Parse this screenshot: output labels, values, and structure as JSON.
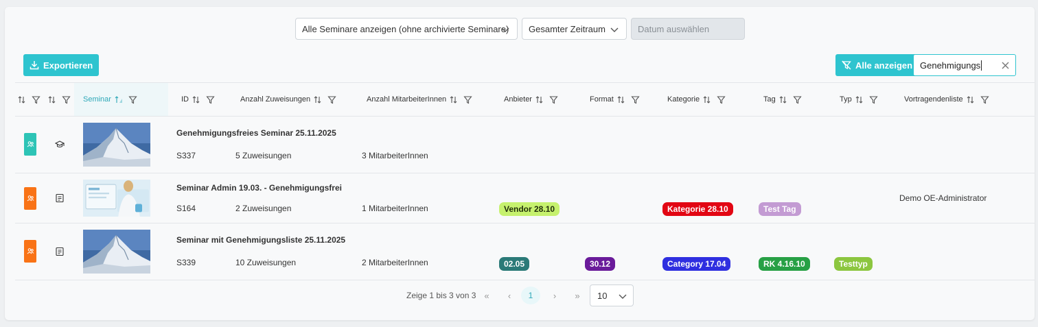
{
  "filters": {
    "seminar_filter": "Alle Seminare anzeigen (ohne archivierte Seminare)",
    "period_filter": "Gesamter Zeitraum",
    "date_placeholder": "Datum auswählen"
  },
  "toolbar": {
    "export_label": "Exportieren",
    "show_all_label": "Alle anzeigen",
    "search_value": "Genehmigungs"
  },
  "columns": {
    "seminar": "Seminar",
    "id": "ID",
    "assignments": "Anzahl Zuweisungen",
    "employees": "Anzahl MitarbeiterInnen",
    "provider": "Anbieter",
    "format": "Format",
    "category": "Kategorie",
    "tag": "Tag",
    "type": "Typ",
    "speakers": "Vortragendenliste"
  },
  "rows": [
    {
      "title": "Genehmigungsfreies Seminar 25.11.2025",
      "id": "S337",
      "assignments": "5 Zuweisungen",
      "employees": "3 MitarbeiterInnen",
      "type_color": "#2ec4b6",
      "row_icon": "graduation-cap-icon",
      "thumbnail": "mountain-image"
    },
    {
      "title": "Seminar Admin 19.03. - Genehmigungsfrei",
      "id": "S164",
      "assignments": "2 Zuweisungen",
      "employees": "1 MitarbeiterInnen",
      "provider": "Vendor 28.10",
      "category": "Kategorie 28.10",
      "tag": "Test Tag",
      "speakers": "Demo OE-Administrator",
      "type_color": "#f97316",
      "row_icon": "document-list-icon",
      "thumbnail": "person-at-computer-image"
    },
    {
      "title": "Seminar mit Genehmigungsliste 25.11.2025",
      "id": "S339",
      "assignments": "10 Zuweisungen",
      "employees": "2 MitarbeiterInnen",
      "provider": "02.05",
      "format": "30.12",
      "category": "Category 17.04",
      "tag": "RK 4.16.10",
      "type": "Testtyp",
      "type_color": "#f97316",
      "row_icon": "document-list-icon",
      "thumbnail": "mountain-image"
    }
  ],
  "pill_colors": {
    "vendor": "#c6f16e",
    "kategorie": "#e20613",
    "test_tag": "#c39bd3",
    "provider_2": "#2b7a78",
    "format_2": "#6a1b9a",
    "category_2": "#2f2fe0",
    "tag_2": "#27a045",
    "type_2": "#8cc63f"
  },
  "pagination": {
    "info": "Zeige 1 bis 3 von 3",
    "current_page": "1",
    "page_size": "10"
  }
}
